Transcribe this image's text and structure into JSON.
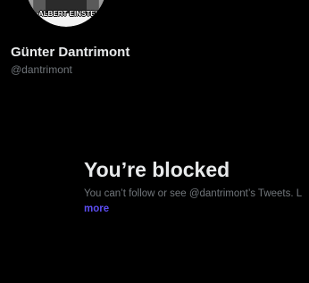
{
  "profile": {
    "avatar_caption": "ALBERT EINSTEIN",
    "display_name": "Günter Dantrimont",
    "handle": "@dantrimont"
  },
  "blocked": {
    "title": "You’re blocked",
    "message": "You can’t follow or see @dantrimont’s Tweets. L",
    "link_label": "more"
  },
  "colors": {
    "background": "#000000",
    "primary_text": "#e7e9ea",
    "secondary_text": "#71767b",
    "link": "#5b4cf0"
  }
}
